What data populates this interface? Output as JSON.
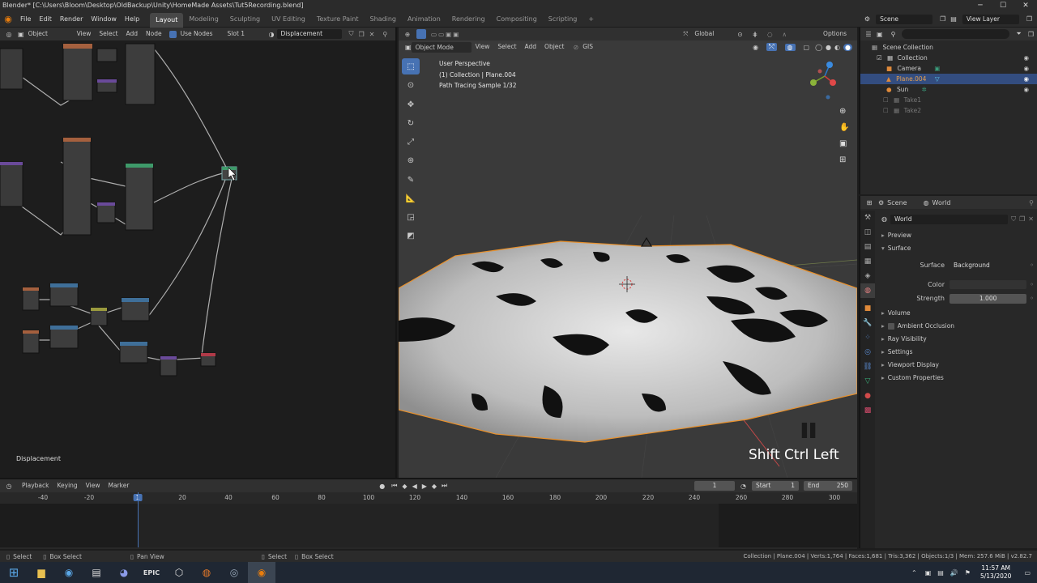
{
  "window": {
    "title": "Blender* [C:\\Users\\Bloom\\Desktop\\OldBackup\\Unity\\HomeMade Assets\\Tut5Recording.blend]",
    "controls": [
      "─",
      "☐",
      "✕"
    ]
  },
  "menu": {
    "items": [
      "File",
      "Edit",
      "Render",
      "Window",
      "Help"
    ],
    "workspaces": [
      "Layout",
      "Modeling",
      "Sculpting",
      "UV Editing",
      "Texture Paint",
      "Shading",
      "Animation",
      "Rendering",
      "Compositing",
      "Scripting"
    ],
    "active_workspace": "Layout",
    "add_tab": "+",
    "scene_name": "Scene",
    "view_layer": "View Layer"
  },
  "node_editor": {
    "header": {
      "type": "Object",
      "menus": [
        "View",
        "Select",
        "Add",
        "Node"
      ],
      "use_nodes_label": "Use Nodes",
      "slot": "Slot 1",
      "material": "Displacement"
    },
    "footer_label": "Displacement"
  },
  "viewport": {
    "mode": "Object Mode",
    "menus": [
      "View",
      "Select",
      "Add",
      "Object",
      "GIS"
    ],
    "orientation": "Global",
    "options_label": "Options",
    "overlay_lines": [
      "User Perspective",
      "(1) Collection | Plane.004",
      "Path Tracing Sample 1/32"
    ],
    "keystroke_overlay": "Shift Ctrl Left",
    "pause_icon": "▌▌",
    "colors": {
      "floor": "#3b3b3b",
      "terrain_light": "#d9d9d9",
      "terrain_dark": "#111111",
      "outline": "#e8912d",
      "x_axis": "#c44848"
    }
  },
  "outliner": {
    "rows": [
      {
        "label": "Scene Collection",
        "indent": 0,
        "state": "normal"
      },
      {
        "label": "Collection",
        "indent": 1,
        "state": "normal"
      },
      {
        "label": "Camera",
        "indent": 2,
        "state": "normal"
      },
      {
        "label": "Plane.004",
        "indent": 2,
        "state": "selected"
      },
      {
        "label": "Sun",
        "indent": 2,
        "state": "normal"
      },
      {
        "label": "Take1",
        "indent": 1,
        "state": "dim"
      },
      {
        "label": "Take2",
        "indent": 1,
        "state": "dim"
      }
    ]
  },
  "properties": {
    "breadcrumb_scene": "Scene",
    "breadcrumb_world": "World",
    "world_name": "World",
    "sections": {
      "preview": "Preview",
      "surface": "Surface",
      "surface_label": "Surface",
      "surface_value": "Background",
      "color_label": "Color",
      "strength_label": "Strength",
      "strength_value": "1.000",
      "volume": "Volume",
      "ambient_occlusion": "Ambient Occlusion",
      "ray_visibility": "Ray Visibility",
      "settings": "Settings",
      "viewport_display": "Viewport Display",
      "custom_properties": "Custom Properties"
    }
  },
  "timeline": {
    "menus": [
      "Playback",
      "Keying",
      "View",
      "Marker"
    ],
    "current_frame": "1",
    "start_label": "Start",
    "start_value": "1",
    "end_label": "End",
    "end_value": "250",
    "ruler_ticks": [
      "-40",
      "-20",
      "1",
      "20",
      "40",
      "60",
      "80",
      "100",
      "120",
      "140",
      "160",
      "180",
      "200",
      "220",
      "240",
      "260",
      "280",
      "300"
    ]
  },
  "statusbar": {
    "left_items": [
      "Select",
      "Box Select",
      "Pan View",
      "Select",
      "Box Select"
    ],
    "info": "Collection | Plane.004 | Verts:1,764 | Faces:1,681 | Tris:3,362 | Objects:1/3 | Mem: 257.6 MiB | v2.82.7"
  },
  "taskbar": {
    "apps": [
      "start",
      "explorer",
      "media",
      "notepad",
      "discord",
      "epic",
      "unity",
      "firefox",
      "steam",
      "blender"
    ],
    "epic_label": "EPIC",
    "time": "11:57 AM",
    "date": "5/13/2020"
  }
}
